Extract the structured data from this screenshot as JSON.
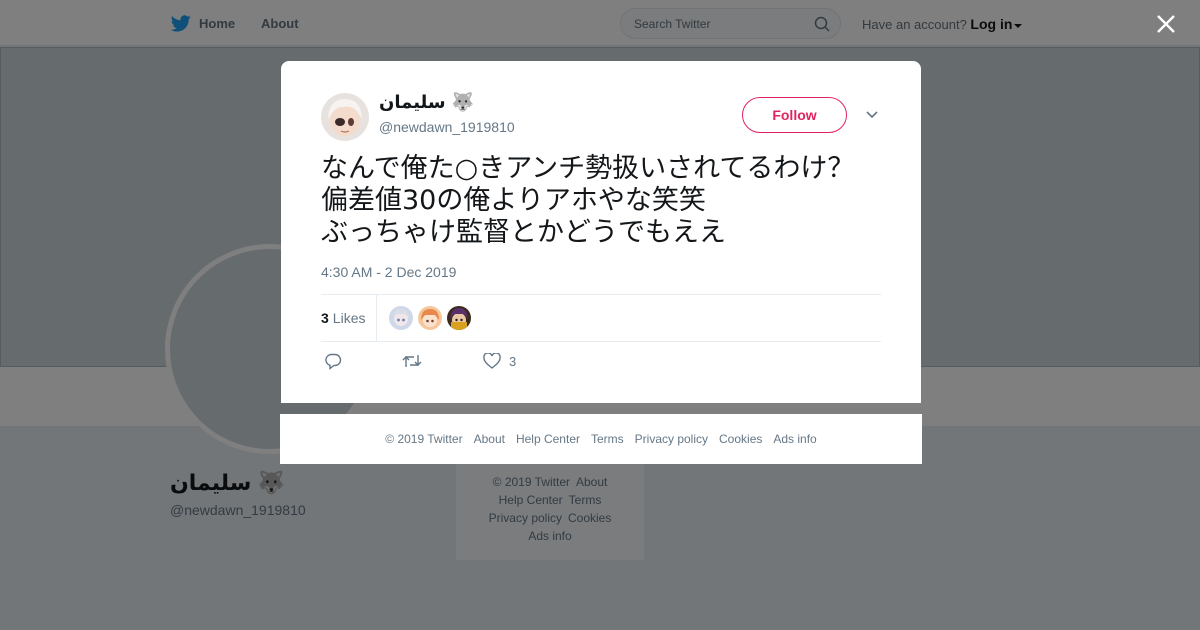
{
  "topbar": {
    "home_label": "Home",
    "about_label": "About",
    "search_placeholder": "Search Twitter",
    "account_prompt": "Have an account?",
    "login_label": "Log in"
  },
  "profile": {
    "name": "سليمان",
    "emoji": "🐺",
    "handle": "@newdawn_1919810"
  },
  "background_footer": {
    "links": [
      "© 2019 Twitter",
      "About",
      "Help Center",
      "Terms",
      "Privacy policy",
      "Cookies",
      "Ads info"
    ]
  },
  "tweet": {
    "author_name": "سليمان",
    "author_emoji": "🐺",
    "author_handle": "@newdawn_1919810",
    "follow_label": "Follow",
    "text_lines": [
      "なんで俺た○きアンチ勢扱いされてるわけ？",
      "偏差値30の俺よりアホやな笑笑",
      "ぶっちゃけ監督とかどうでもええ"
    ],
    "timestamp": "4:30 AM - 2 Dec 2019",
    "likes_count": "3",
    "likes_label": "Likes",
    "like_action_count": "3"
  },
  "modal_footer": {
    "links": [
      "© 2019 Twitter",
      "About",
      "Help Center",
      "Terms",
      "Privacy policy",
      "Cookies",
      "Ads info"
    ]
  },
  "colors": {
    "twitter_blue": "#1da1f2",
    "follow_red": "#e0245e",
    "text_dark": "#14171a",
    "text_gray": "#657786"
  }
}
